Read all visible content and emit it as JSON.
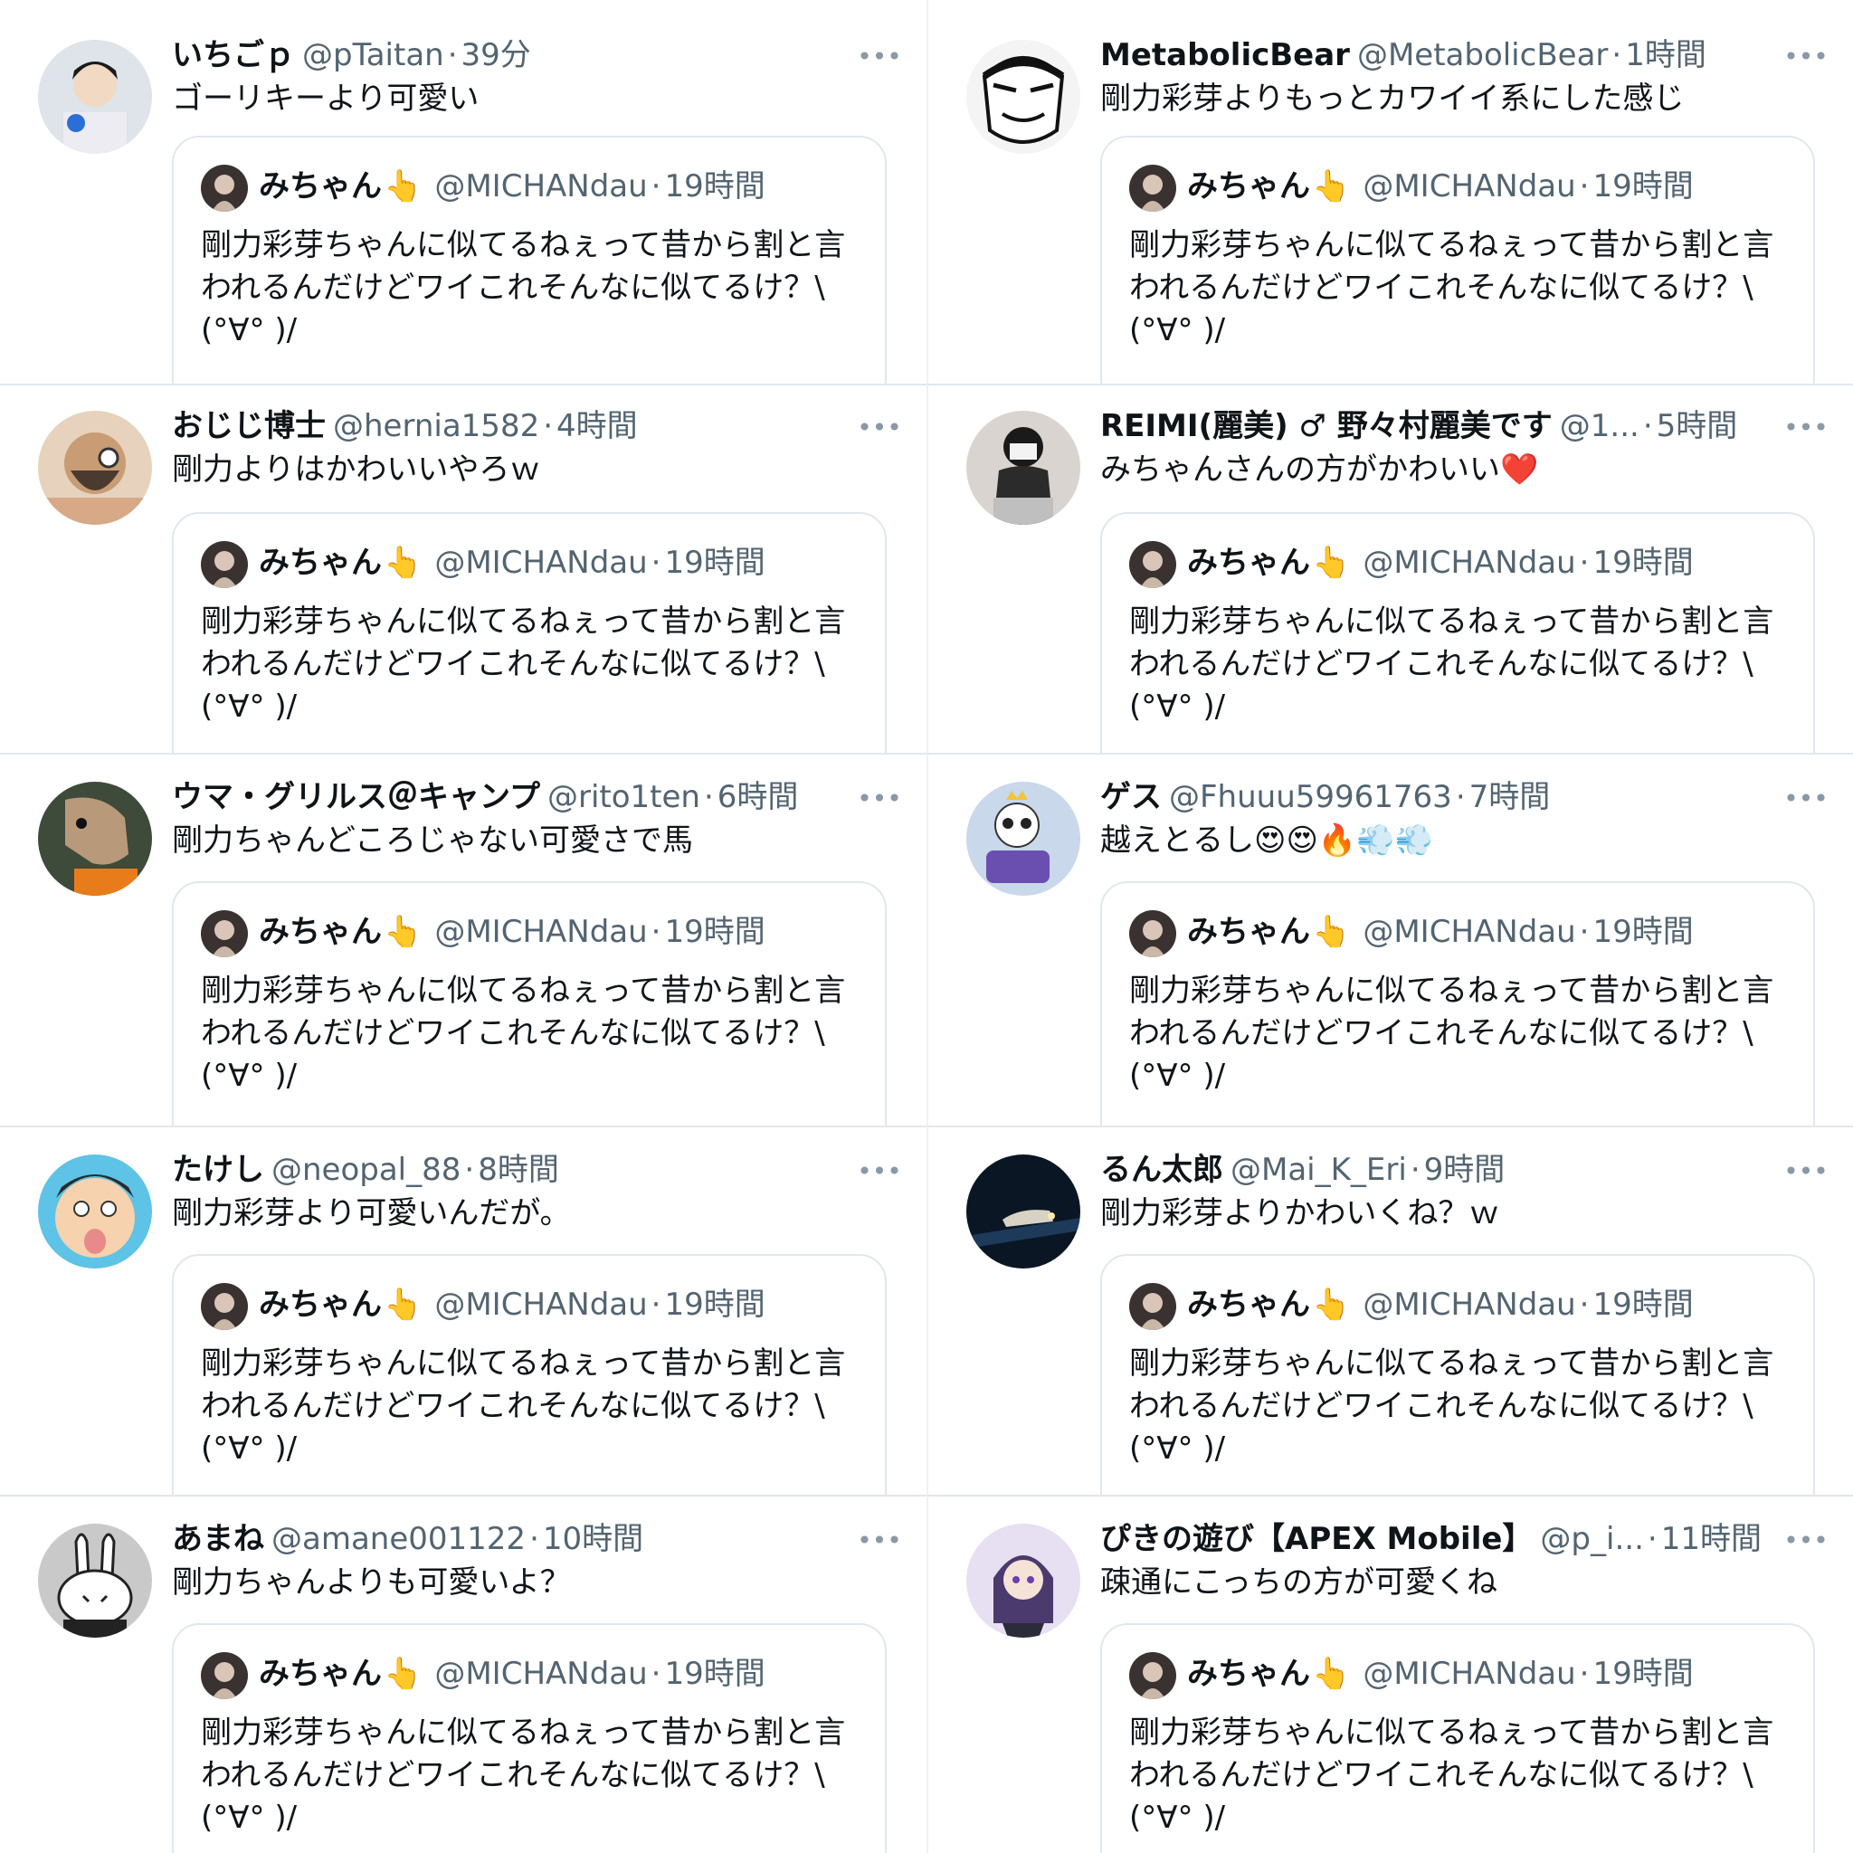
{
  "quote": {
    "name": "みちゃん",
    "emoji": "👆",
    "handle": "@MICHANdau",
    "time": "19時間",
    "text": "剛力彩芽ちゃんに似てるねぇって昔から割と言\nわれるんだけどワイこれそんなに似てるけ？\\\n(°∀° )/"
  },
  "tweets": [
    {
      "name": "いちごｐ",
      "handle": "@pTaitan",
      "time": "39分",
      "reply": "ゴーリキーより可愛い"
    },
    {
      "name": "MetabolicBear",
      "handle": "@MetabolicBear",
      "time": "1時間",
      "reply": "剛力彩芽よりもっとカワイイ系にした感じ"
    },
    {
      "name": "おじじ博士",
      "handle": "@hernia1582",
      "time": "4時間",
      "reply": "剛力よりはかわいいやろｗ"
    },
    {
      "name": "REIMI(麗美) ♂ 野々村麗美です",
      "handle": "@1...",
      "time": "5時間",
      "reply": "みちゃんさんの方がかわいい❤️"
    },
    {
      "name": "ウマ・グリルス＠キャンプ",
      "handle": "@rito1ten",
      "time": "6時間",
      "reply": "剛力ちゃんどころじゃない可愛さで馬"
    },
    {
      "name": "ゲス",
      "handle": "@Fhuuu59961763",
      "time": "7時間",
      "reply": "越えとるし😍😍🔥💨💨"
    },
    {
      "name": "たけし",
      "handle": "@neopal_88",
      "time": "8時間",
      "reply": "剛力彩芽より可愛いんだが。"
    },
    {
      "name": "るん太郎",
      "handle": "@Mai_K_Eri",
      "time": "9時間",
      "reply": "剛力彩芽よりかわいくね？ｗ"
    },
    {
      "name": "あまね",
      "handle": "@amane001122",
      "time": "10時間",
      "reply": "剛力ちゃんよりも可愛いよ？"
    },
    {
      "name": "ぴきの遊び【APEX Mobile】",
      "handle": "@p_i...",
      "time": "11時間",
      "reply": "疎通にこっちの方が可愛くね"
    }
  ],
  "more_label": "•••",
  "separator": "·",
  "colors": {
    "text": "#0f1419",
    "secondary": "#536471",
    "border": "#e1e8ed"
  }
}
